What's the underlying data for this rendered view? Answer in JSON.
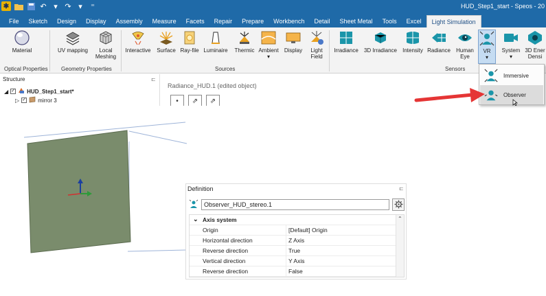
{
  "window": {
    "title": "HUD_Step1_start - Speos - 20"
  },
  "menu": {
    "tabs": [
      "File",
      "Sketch",
      "Design",
      "Display",
      "Assembly",
      "Measure",
      "Facets",
      "Repair",
      "Prepare",
      "Workbench",
      "Detail",
      "Sheet Metal",
      "Tools",
      "Excel",
      "Light Simulation"
    ],
    "active": "Light Simulation"
  },
  "ribbon": {
    "groups": {
      "optical": "Optical Properties",
      "geometry": "Geometry Properties",
      "sources": "Sources",
      "sensors": "Sensors"
    },
    "buttons": {
      "material": "Material",
      "uv_mapping": "UV mapping",
      "local_meshing": [
        "Local",
        "Meshing"
      ],
      "interactive": "Interactive",
      "surface": "Surface",
      "ray_file": "Ray-file",
      "luminaire": "Luminaire",
      "thermic": "Thermic",
      "ambient": "Ambient",
      "display": "Display",
      "light_field": [
        "Light",
        "Field"
      ],
      "irradiance": "Irradiance",
      "irradiance_3d": "3D Irradiance",
      "intensity": "Intensity",
      "radiance": "Radiance",
      "human_eye": [
        "Human",
        "Eye"
      ],
      "vr": "VR",
      "system": "System",
      "energy_density": [
        "3D Ener",
        "Densi"
      ]
    }
  },
  "vr_menu": {
    "items": [
      "Immersive",
      "Observer"
    ],
    "highlighted": "Observer"
  },
  "structure": {
    "title": "Structure",
    "items": [
      {
        "label": "HUD_Step1_start*",
        "bold": true
      },
      {
        "label": "mirror 3",
        "bold": false
      }
    ]
  },
  "editor": {
    "title": "Radiance_HUD.1 (edited object)"
  },
  "definition": {
    "title": "Definition",
    "name_value": "Observer_HUD_stereo.1",
    "section": "Axis system",
    "rows": [
      {
        "key": "Origin",
        "value": "[Default] Origin"
      },
      {
        "key": "Horizontal direction",
        "value": "Z Axis"
      },
      {
        "key": "Reverse direction",
        "value": "True"
      },
      {
        "key": "Vertical direction",
        "value": "Y Axis"
      },
      {
        "key": "Reverse direction",
        "value": "False"
      }
    ]
  },
  "colors": {
    "title_bar": "#1f6aa8",
    "ribbon_bg": "#f3f3f3",
    "panel_fill": "#7a8c6c",
    "arrow": "#e53535",
    "icon_teal": "#1a95a9",
    "icon_orange": "#e7a22b"
  }
}
